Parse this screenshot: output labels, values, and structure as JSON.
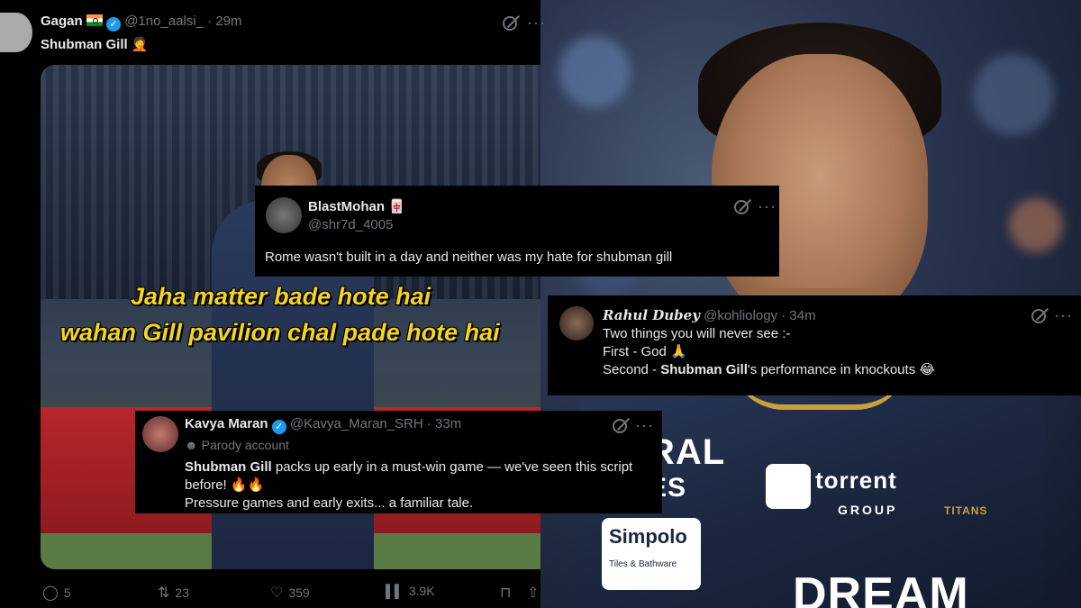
{
  "main_tweet": {
    "display_name": "Gagan",
    "handle": "@1no_aalsi_",
    "time": "29m",
    "text": "Shubman Gill",
    "text_emoji": "🤦",
    "meme_line_1": "Jaha matter bade hote hai",
    "meme_line_2": "wahan Gill pavilion chal pade hote hai",
    "actions": {
      "replies": "5",
      "reposts": "23",
      "likes": "359",
      "views": "3.9K"
    }
  },
  "blast_tweet": {
    "display_name": "BlastMohan",
    "name_emoji": "🀄",
    "handle": "@shr7d_4005",
    "text": "Rome wasn't built in a day and neither was my hate for shubman gill"
  },
  "rahul_tweet": {
    "display_name": "Rahul Dubey",
    "handle": "@kohliology",
    "time": "34m",
    "line1": "Two things you will never see :-",
    "line2": "First - God 🙏",
    "line3_prefix": "Second - ",
    "line3_bold": "Shubman Gill",
    "line3_suffix": "'s performance in knockouts 😂"
  },
  "kavya_tweet": {
    "display_name": "Kavya Maran",
    "handle": "@Kavya_Maran_SRH",
    "time": "33m",
    "parody_label": "Parody account",
    "bold_name": "Shubman Gill",
    "line1_rest": " packs up early in a must-win game — we've seen this script",
    "line2": "before! 🔥🔥",
    "line3": "Pressure games and early exits... a familiar tale."
  },
  "photo_text": {
    "sponsor1": "torrent",
    "sponsor1_sub": "GROUP",
    "sponsor2": "Simpolo",
    "sponsor2_sub": "Tiles & Bathware",
    "chest": "RAL",
    "chest2": "ES",
    "titans": "TITANS",
    "bottom": "DREAM"
  },
  "colors": {
    "accent": "#1d9bf0",
    "muted": "#71767b",
    "meme_yellow": "#f5d51e"
  },
  "icons": [
    "retweet-icon",
    "heart-icon",
    "reply-icon",
    "views-icon",
    "bookmark-icon",
    "share-icon",
    "more-icon",
    "grok-icon",
    "verified-icon"
  ]
}
